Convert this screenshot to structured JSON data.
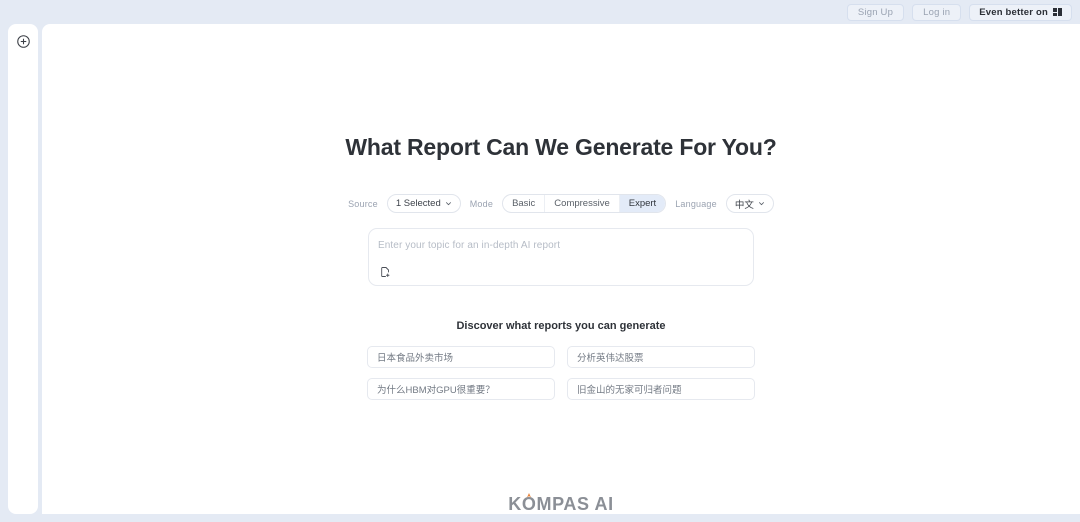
{
  "window": {
    "background_color": "#e4eaf4",
    "panel_color": "#ffffff"
  },
  "sidebar": {
    "new_chat_icon": "plus-circle-icon"
  },
  "topbar": {
    "buttons": [
      {
        "label": "Sign Up",
        "name": "sign-up-button"
      },
      {
        "label": "Log in",
        "name": "log-in-button"
      },
      {
        "label": "Even better on",
        "name": "even-better-on-button",
        "icon": "windows-icon"
      }
    ]
  },
  "hero": {
    "title": "What Report Can We Generate For You?"
  },
  "options": {
    "source": {
      "label": "Source",
      "value": "1 Selected",
      "icon": "chevron-down-icon"
    },
    "mode": {
      "label": "Mode",
      "items": [
        {
          "label": "Basic",
          "selected": false
        },
        {
          "label": "Compressive",
          "selected": false
        },
        {
          "label": "Expert",
          "selected": true
        }
      ],
      "selected": "Expert"
    },
    "language": {
      "label": "Language",
      "value": "中文",
      "icon": "chevron-down-icon"
    }
  },
  "composer": {
    "placeholder": "Enter your topic for an in-depth AI report",
    "value": "",
    "attach_icon": "file-add-icon"
  },
  "suggestions": {
    "heading": "Discover what reports you can generate",
    "chips": [
      {
        "label": "日本食品外卖市场"
      },
      {
        "label": "分析英伟达股票"
      },
      {
        "label": "为什么HBM对GPU很重要？"
      },
      {
        "label": "旧金山的无家可归者问题"
      }
    ]
  },
  "footer": {
    "logo_text": "KOMPAS AI",
    "logo_accent_color": "#e8833a",
    "logo_color": "#8b8f96"
  }
}
